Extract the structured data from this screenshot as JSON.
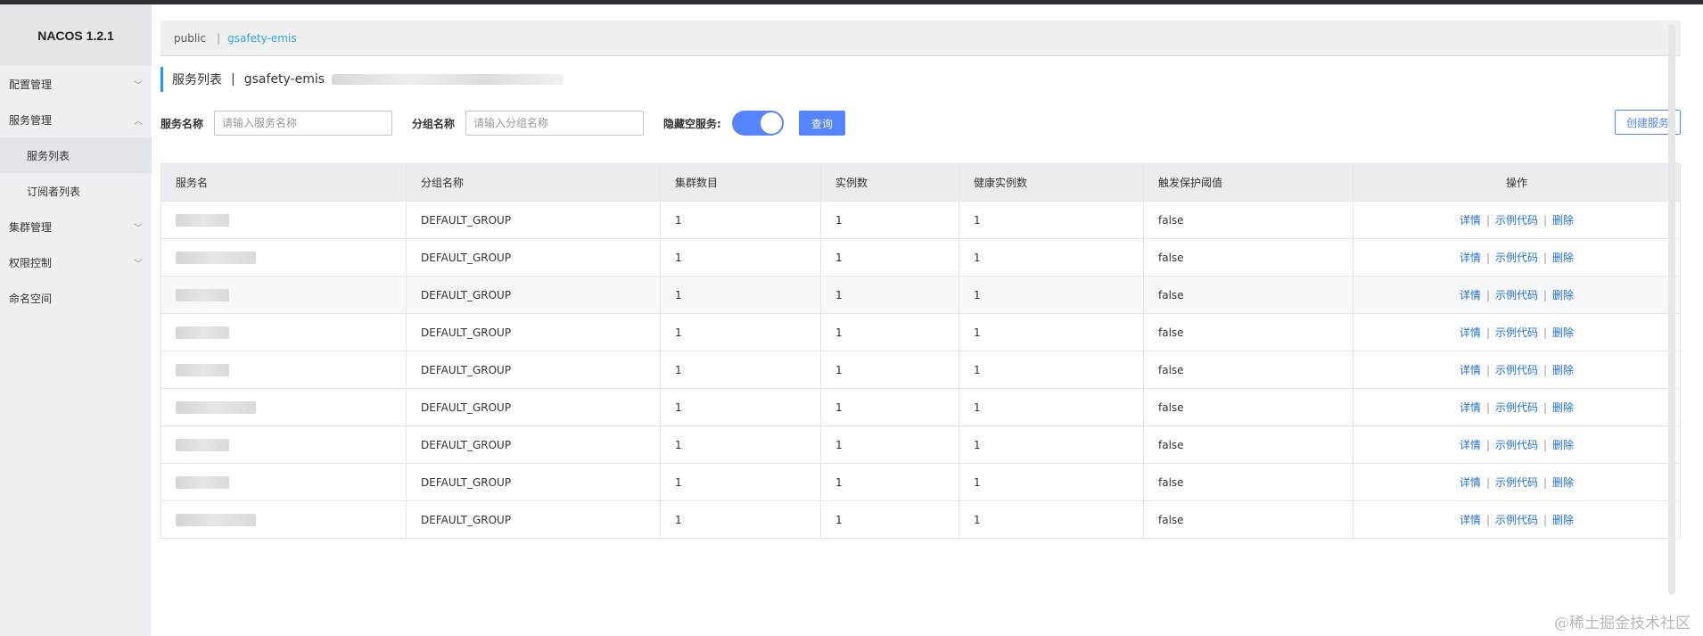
{
  "app": {
    "brand": "NACOS 1.2.1"
  },
  "sidebar": {
    "items": [
      {
        "label": "配置管理",
        "expanded": false
      },
      {
        "label": "服务管理",
        "expanded": true
      },
      {
        "label": "服务列表",
        "sub": true,
        "active": true
      },
      {
        "label": "订阅者列表",
        "sub": true
      },
      {
        "label": "集群管理",
        "expanded": false
      },
      {
        "label": "权限控制",
        "expanded": false
      },
      {
        "label": "命名空间"
      }
    ],
    "chevron_down": "chevron-down-icon",
    "chevron_up": "chevron-up-icon"
  },
  "namespaces": {
    "items": [
      "public",
      "gsafety-emis"
    ],
    "separator": "|",
    "active": "gsafety-emis"
  },
  "page": {
    "title": "服务列表",
    "separator": "|",
    "namespace": "gsafety-emis"
  },
  "filters": {
    "service_name_label": "服务名称",
    "service_name_placeholder": "请输入服务名称",
    "group_name_label": "分组名称",
    "group_name_placeholder": "请输入分组名称",
    "hide_empty_label": "隐藏空服务:",
    "hide_empty_on": true,
    "query_button": "查询",
    "create_button": "创建服务"
  },
  "table": {
    "headers": [
      "服务名",
      "分组名称",
      "集群数目",
      "实例数",
      "健康实例数",
      "触发保护阈值",
      "操作"
    ],
    "rows": [
      {
        "group": "DEFAULT_GROUP",
        "clusters": "1",
        "instances": "1",
        "healthy": "1",
        "protect": "false"
      },
      {
        "group": "DEFAULT_GROUP",
        "clusters": "1",
        "instances": "1",
        "healthy": "1",
        "protect": "false"
      },
      {
        "group": "DEFAULT_GROUP",
        "clusters": "1",
        "instances": "1",
        "healthy": "1",
        "protect": "false"
      },
      {
        "group": "DEFAULT_GROUP",
        "clusters": "1",
        "instances": "1",
        "healthy": "1",
        "protect": "false"
      },
      {
        "group": "DEFAULT_GROUP",
        "clusters": "1",
        "instances": "1",
        "healthy": "1",
        "protect": "false"
      },
      {
        "group": "DEFAULT_GROUP",
        "clusters": "1",
        "instances": "1",
        "healthy": "1",
        "protect": "false"
      },
      {
        "group": "DEFAULT_GROUP",
        "clusters": "1",
        "instances": "1",
        "healthy": "1",
        "protect": "false"
      },
      {
        "group": "DEFAULT_GROUP",
        "clusters": "1",
        "instances": "1",
        "healthy": "1",
        "protect": "false"
      },
      {
        "group": "DEFAULT_GROUP",
        "clusters": "1",
        "instances": "1",
        "healthy": "1",
        "protect": "false"
      }
    ],
    "ops": {
      "detail": "详情",
      "sample": "示例代码",
      "delete": "删除",
      "separator": "|"
    }
  },
  "watermark": "@稀土掘金技术社区",
  "colors": {
    "primary": "#5584ff",
    "namespace_active": "#29a8e0",
    "link": "#1f6fc9",
    "title_accent": "#209bfa"
  }
}
